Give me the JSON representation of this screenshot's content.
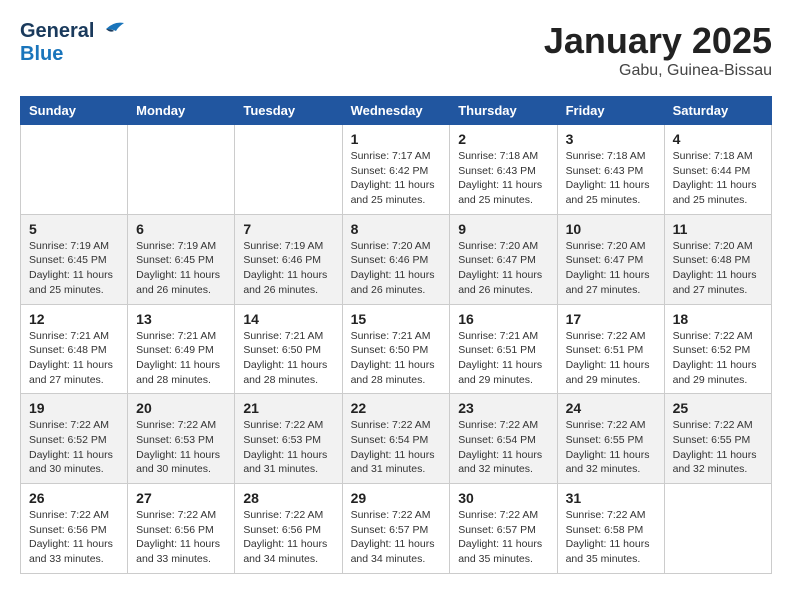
{
  "header": {
    "logo_general": "General",
    "logo_blue": "Blue",
    "title": "January 2025",
    "subtitle": "Gabu, Guinea-Bissau"
  },
  "weekdays": [
    "Sunday",
    "Monday",
    "Tuesday",
    "Wednesday",
    "Thursday",
    "Friday",
    "Saturday"
  ],
  "weeks": [
    [
      {
        "day": "",
        "info": ""
      },
      {
        "day": "",
        "info": ""
      },
      {
        "day": "",
        "info": ""
      },
      {
        "day": "1",
        "info": "Sunrise: 7:17 AM\nSunset: 6:42 PM\nDaylight: 11 hours\nand 25 minutes."
      },
      {
        "day": "2",
        "info": "Sunrise: 7:18 AM\nSunset: 6:43 PM\nDaylight: 11 hours\nand 25 minutes."
      },
      {
        "day": "3",
        "info": "Sunrise: 7:18 AM\nSunset: 6:43 PM\nDaylight: 11 hours\nand 25 minutes."
      },
      {
        "day": "4",
        "info": "Sunrise: 7:18 AM\nSunset: 6:44 PM\nDaylight: 11 hours\nand 25 minutes."
      }
    ],
    [
      {
        "day": "5",
        "info": "Sunrise: 7:19 AM\nSunset: 6:45 PM\nDaylight: 11 hours\nand 25 minutes."
      },
      {
        "day": "6",
        "info": "Sunrise: 7:19 AM\nSunset: 6:45 PM\nDaylight: 11 hours\nand 26 minutes."
      },
      {
        "day": "7",
        "info": "Sunrise: 7:19 AM\nSunset: 6:46 PM\nDaylight: 11 hours\nand 26 minutes."
      },
      {
        "day": "8",
        "info": "Sunrise: 7:20 AM\nSunset: 6:46 PM\nDaylight: 11 hours\nand 26 minutes."
      },
      {
        "day": "9",
        "info": "Sunrise: 7:20 AM\nSunset: 6:47 PM\nDaylight: 11 hours\nand 26 minutes."
      },
      {
        "day": "10",
        "info": "Sunrise: 7:20 AM\nSunset: 6:47 PM\nDaylight: 11 hours\nand 27 minutes."
      },
      {
        "day": "11",
        "info": "Sunrise: 7:20 AM\nSunset: 6:48 PM\nDaylight: 11 hours\nand 27 minutes."
      }
    ],
    [
      {
        "day": "12",
        "info": "Sunrise: 7:21 AM\nSunset: 6:48 PM\nDaylight: 11 hours\nand 27 minutes."
      },
      {
        "day": "13",
        "info": "Sunrise: 7:21 AM\nSunset: 6:49 PM\nDaylight: 11 hours\nand 28 minutes."
      },
      {
        "day": "14",
        "info": "Sunrise: 7:21 AM\nSunset: 6:50 PM\nDaylight: 11 hours\nand 28 minutes."
      },
      {
        "day": "15",
        "info": "Sunrise: 7:21 AM\nSunset: 6:50 PM\nDaylight: 11 hours\nand 28 minutes."
      },
      {
        "day": "16",
        "info": "Sunrise: 7:21 AM\nSunset: 6:51 PM\nDaylight: 11 hours\nand 29 minutes."
      },
      {
        "day": "17",
        "info": "Sunrise: 7:22 AM\nSunset: 6:51 PM\nDaylight: 11 hours\nand 29 minutes."
      },
      {
        "day": "18",
        "info": "Sunrise: 7:22 AM\nSunset: 6:52 PM\nDaylight: 11 hours\nand 29 minutes."
      }
    ],
    [
      {
        "day": "19",
        "info": "Sunrise: 7:22 AM\nSunset: 6:52 PM\nDaylight: 11 hours\nand 30 minutes."
      },
      {
        "day": "20",
        "info": "Sunrise: 7:22 AM\nSunset: 6:53 PM\nDaylight: 11 hours\nand 30 minutes."
      },
      {
        "day": "21",
        "info": "Sunrise: 7:22 AM\nSunset: 6:53 PM\nDaylight: 11 hours\nand 31 minutes."
      },
      {
        "day": "22",
        "info": "Sunrise: 7:22 AM\nSunset: 6:54 PM\nDaylight: 11 hours\nand 31 minutes."
      },
      {
        "day": "23",
        "info": "Sunrise: 7:22 AM\nSunset: 6:54 PM\nDaylight: 11 hours\nand 32 minutes."
      },
      {
        "day": "24",
        "info": "Sunrise: 7:22 AM\nSunset: 6:55 PM\nDaylight: 11 hours\nand 32 minutes."
      },
      {
        "day": "25",
        "info": "Sunrise: 7:22 AM\nSunset: 6:55 PM\nDaylight: 11 hours\nand 32 minutes."
      }
    ],
    [
      {
        "day": "26",
        "info": "Sunrise: 7:22 AM\nSunset: 6:56 PM\nDaylight: 11 hours\nand 33 minutes."
      },
      {
        "day": "27",
        "info": "Sunrise: 7:22 AM\nSunset: 6:56 PM\nDaylight: 11 hours\nand 33 minutes."
      },
      {
        "day": "28",
        "info": "Sunrise: 7:22 AM\nSunset: 6:56 PM\nDaylight: 11 hours\nand 34 minutes."
      },
      {
        "day": "29",
        "info": "Sunrise: 7:22 AM\nSunset: 6:57 PM\nDaylight: 11 hours\nand 34 minutes."
      },
      {
        "day": "30",
        "info": "Sunrise: 7:22 AM\nSunset: 6:57 PM\nDaylight: 11 hours\nand 35 minutes."
      },
      {
        "day": "31",
        "info": "Sunrise: 7:22 AM\nSunset: 6:58 PM\nDaylight: 11 hours\nand 35 minutes."
      },
      {
        "day": "",
        "info": ""
      }
    ]
  ]
}
